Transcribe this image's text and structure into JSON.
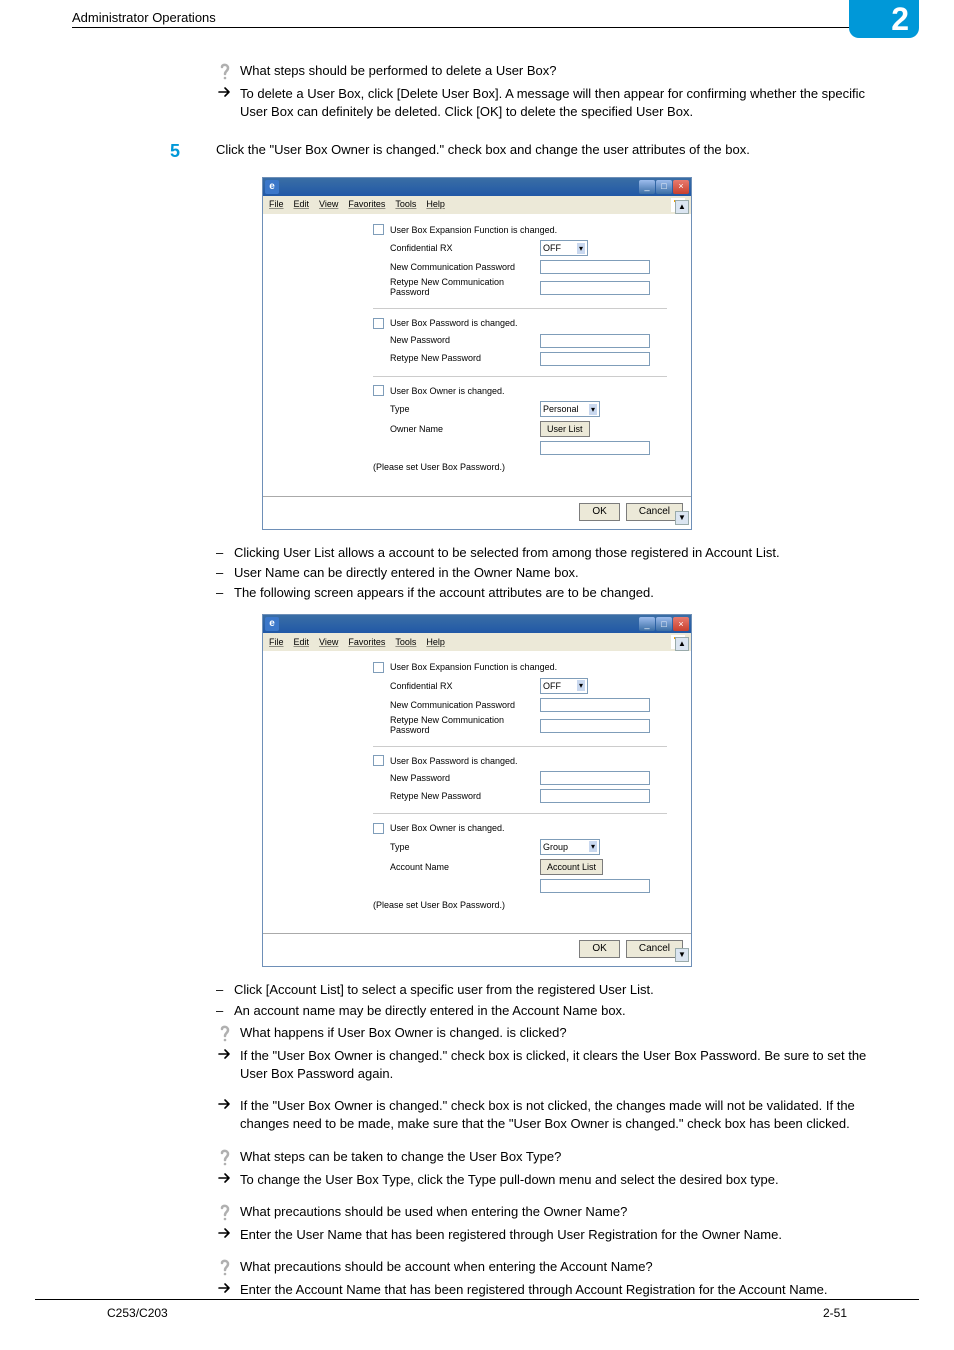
{
  "header": {
    "section_title": "Administrator Operations",
    "chapter": "2"
  },
  "qa_top": {
    "question": "What steps should be performed to delete a User Box?",
    "answer": "To delete a User Box, click [Delete User Box]. A message will then appear for confirming whether the specific User Box can definitely be deleted. Click [OK] to delete the specified User Box."
  },
  "step5": {
    "number": "5",
    "text": "Click the \"User Box Owner is changed.\" check box and change the user attributes of the box."
  },
  "screenshot_common": {
    "menu_file": "File",
    "menu_edit": "Edit",
    "menu_view": "View",
    "menu_fav": "Favorites",
    "menu_tools": "Tools",
    "menu_help": "Help",
    "g1_title": "User Box Expansion Function is changed.",
    "g1_l1": "Confidential RX",
    "g1_sel": "OFF",
    "g1_l2": "New Communication Password",
    "g1_l3": "Retype New Communication Password",
    "g2_title": "User Box Password is changed.",
    "g2_l1": "New Password",
    "g2_l2": "Retype New Password",
    "g3_title": "User Box Owner is changed.",
    "g3_type": "Type",
    "please": "(Please set User Box Password.)",
    "ok": "OK",
    "cancel": "Cancel"
  },
  "shot1": {
    "owner_type": "Personal",
    "name_label": "Owner Name",
    "list_btn": "User List"
  },
  "shot2": {
    "owner_type": "Group",
    "name_label": "Account Name",
    "list_btn": "Account List"
  },
  "bullets1": {
    "b1": "Clicking User List allows a account to be selected from among those registered in Account List.",
    "b2": "User Name can be directly entered in the Owner Name box.",
    "b3": "The following screen appears if the account attributes are to be changed."
  },
  "bullets2": {
    "b1": "Click [Account List] to select a specific user from the registered User List.",
    "b2": "An account name may be directly entered in the Account Name box."
  },
  "qa1": {
    "q": "What happens if User Box Owner is changed. is clicked?",
    "a": "If the \"User Box Owner is changed.\" check box is clicked, it clears the User Box Password. Be sure to set the User Box Password again."
  },
  "qa2": {
    "a": "If the \"User Box Owner is changed.\" check box is not clicked, the changes made will not be validated. If the changes need to be made, make sure that the \"User Box Owner is changed.\" check box has been clicked."
  },
  "qa3": {
    "q": "What steps can be taken to change the User Box Type?",
    "a": "To change the User Box Type, click the Type pull-down menu and select the desired box type."
  },
  "qa4": {
    "q": "What precautions should be used when entering the Owner Name?",
    "a": "Enter the User Name that has been registered through User Registration for the Owner Name."
  },
  "qa5": {
    "q": "What precautions should be account when entering the Account Name?",
    "a": "Enter the Account Name that has been registered through Account Registration for the Account Name."
  },
  "footer": {
    "left": "C253/C203",
    "right": "2-51"
  }
}
